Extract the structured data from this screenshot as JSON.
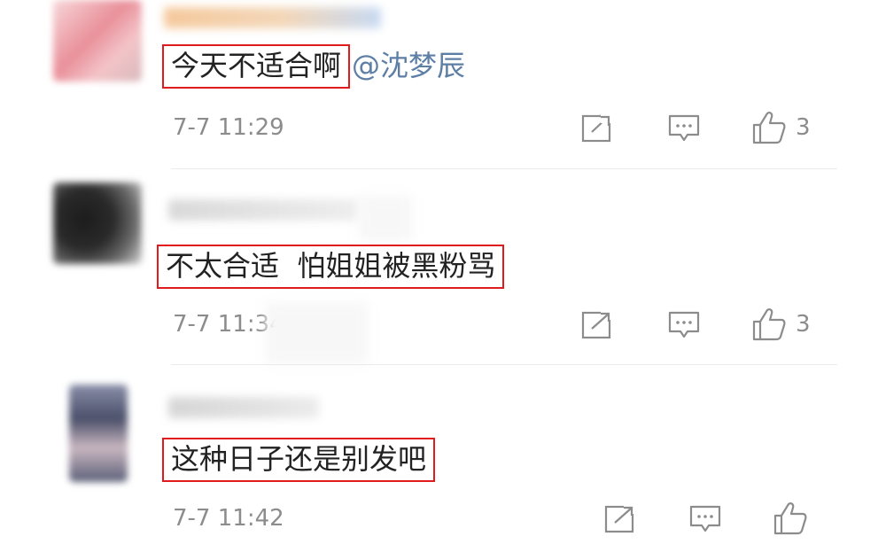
{
  "comments": [
    {
      "text": "今天不适合啊",
      "mention": "@沈梦辰",
      "time": "7-7 11:29",
      "likes": "3",
      "avatar_colors": [
        "#f3c4c8",
        "#e9909a",
        "#f7d7d9"
      ],
      "name_colors": [
        "#f5c99c",
        "#c7d9f2"
      ]
    },
    {
      "text": "不太合适  怕姐姐被黑粉骂",
      "mention": "",
      "time": "7-7 11:34",
      "likes": "3",
      "avatar_colors": [
        "#2a2a2a",
        "#6b6b6b",
        "#b0b0b0"
      ],
      "name_colors": [
        "#d9d9d9",
        "#eeeeee"
      ]
    },
    {
      "text": "这种日子还是别发吧",
      "mention": "",
      "time": "7-7 11:42",
      "likes": "",
      "avatar_colors": [
        "#4a4f6a",
        "#c9b7c0",
        "#8a8fa8"
      ],
      "name_colors": [
        "#d6d6d6",
        "#ececec"
      ]
    }
  ],
  "icons": {
    "share": "share-icon",
    "comment": "comment-icon",
    "like": "thumbs-up-icon"
  },
  "colors": {
    "highlight_border": "#e11b1b",
    "mention": "#5d7ea5",
    "meta_text": "#8c8c8c"
  }
}
